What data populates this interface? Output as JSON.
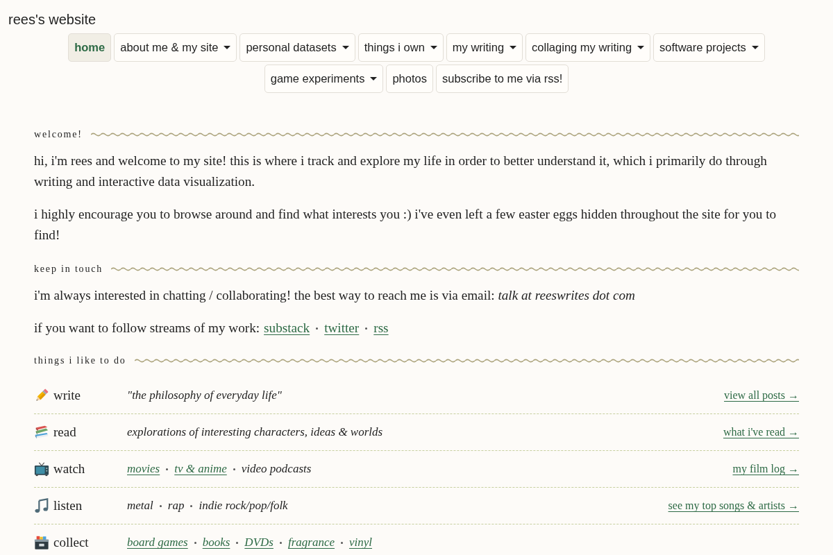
{
  "site_title": "rees's website",
  "nav": [
    {
      "label": "home",
      "selected": true,
      "dropdown": false
    },
    {
      "label": "about me & my site",
      "selected": false,
      "dropdown": true
    },
    {
      "label": "personal datasets",
      "selected": false,
      "dropdown": true
    },
    {
      "label": "things i own",
      "selected": false,
      "dropdown": true
    },
    {
      "label": "my writing",
      "selected": false,
      "dropdown": true
    },
    {
      "label": "collaging my writing",
      "selected": false,
      "dropdown": true
    },
    {
      "label": "software projects",
      "selected": false,
      "dropdown": true
    },
    {
      "label": "game experiments",
      "selected": false,
      "dropdown": true
    },
    {
      "label": "photos",
      "selected": false,
      "dropdown": false
    },
    {
      "label": "subscribe to me via rss!",
      "selected": false,
      "dropdown": false
    }
  ],
  "sections": [
    {
      "kind": "text",
      "heading": "welcome!",
      "paragraphs": [
        "hi, i'm rees and welcome to my site! this is where i track and explore my life in order to better understand it, which i primarily do through writing and interactive data visualization.",
        "i highly encourage you to browse around and find what interests you :) i've even left a few easter eggs hidden throughout the site for you to find!"
      ]
    },
    {
      "kind": "contact",
      "heading": "keep in touch",
      "paragraphs": [
        "i'm always interested in chatting / collaborating! the best way to reach me is via email: *talk at reeswrites dot com*"
      ],
      "follow": {
        "text": "if you want to follow streams of my work:",
        "links": [
          "substack",
          "twitter",
          "rss"
        ]
      }
    },
    {
      "kind": "activities",
      "heading": "things i like to do",
      "activities": [
        {
          "label": "write",
          "items": [
            {
              "kind": "text",
              "text": "\"the philosophy of everyday life\""
            }
          ],
          "link": "view all posts →"
        },
        {
          "label": "read",
          "items": [
            {
              "kind": "text",
              "text": "explorations of interesting characters, ideas & worlds"
            }
          ],
          "link": "what i've read →"
        },
        {
          "label": "watch",
          "items": [
            {
              "kind": "link",
              "text": "movies"
            },
            {
              "kind": "link",
              "text": "tv & anime"
            },
            {
              "kind": "text",
              "text": "video podcasts"
            }
          ],
          "link": "my film log →"
        },
        {
          "label": "listen",
          "items": [
            {
              "kind": "text",
              "text": "metal"
            },
            {
              "kind": "text",
              "text": "rap"
            },
            {
              "kind": "text",
              "text": "indie rock/pop/folk"
            }
          ],
          "link": "see my top songs & artists →"
        },
        {
          "label": "collect",
          "items": [
            {
              "kind": "link",
              "text": "board games"
            },
            {
              "kind": "link",
              "text": "books"
            },
            {
              "kind": "link",
              "text": "DVDs"
            },
            {
              "kind": "link",
              "text": "fragrance"
            },
            {
              "kind": "link",
              "text": "vinyl"
            }
          ]
        }
      ]
    }
  ]
}
